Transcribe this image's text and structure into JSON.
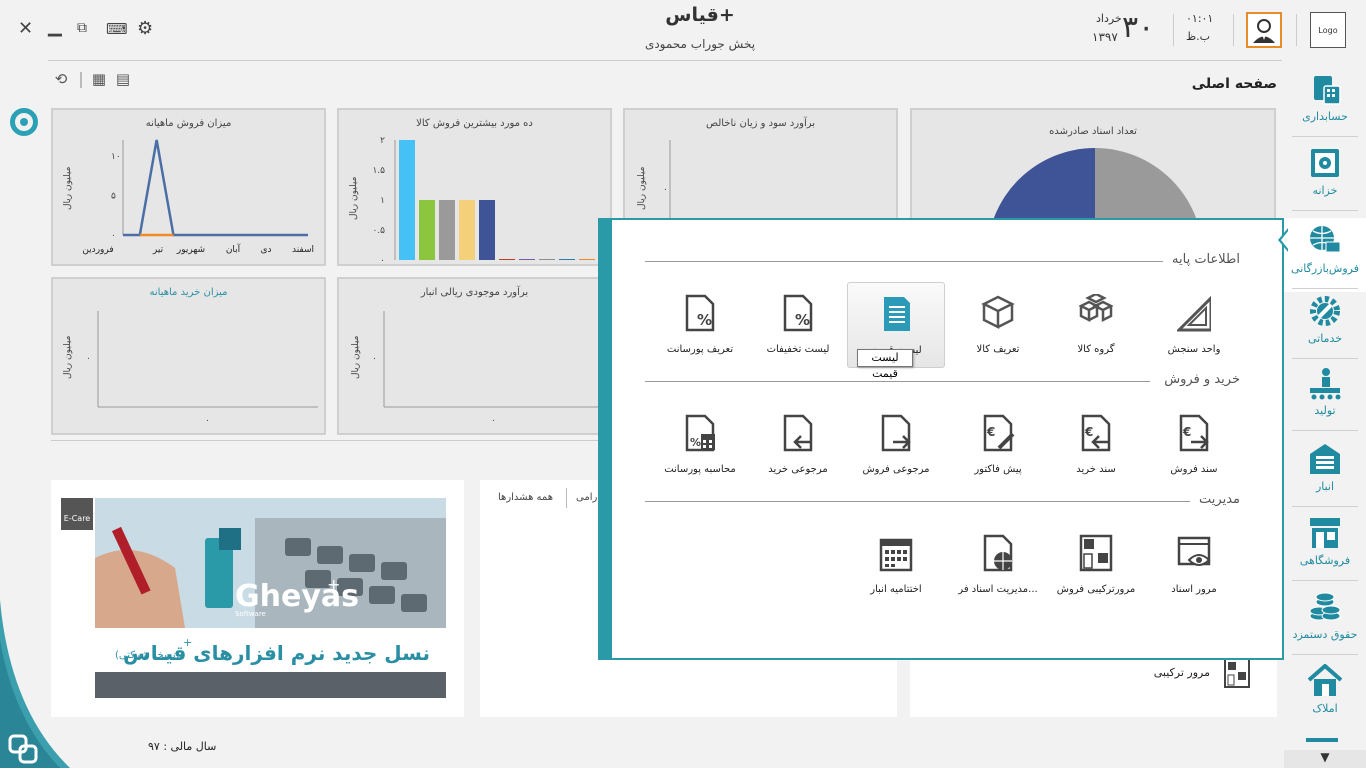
{
  "app": {
    "title": "قیاس+",
    "subtitle": "پخش جوراب محمودی",
    "logo_text": "Logo"
  },
  "header": {
    "day": "۳۰",
    "month": "خرداد",
    "year": "۱۳۹۷",
    "time": "۰۱:۰۱",
    "ampm": "ب.ظ",
    "page_title": "صفحه اصلی"
  },
  "window_controls": [
    "close-icon",
    "minimize-icon",
    "restore-icon",
    "keyboard-icon",
    "settings-icon"
  ],
  "toolbar_icons": [
    "refresh-icon",
    "grid-icon",
    "calendar-icon"
  ],
  "charts": [
    {
      "title": "میزان فروش ماهیانه",
      "ylabel": "میلیون ریال",
      "chart_data": {
        "type": "line",
        "categories": [
          "فروردین",
          "تیر",
          "شهریور",
          "آبان",
          "دی",
          "اسفند"
        ],
        "yticks": [
          "۰",
          "۵",
          "۱۰"
        ],
        "ylim": [
          0,
          12
        ],
        "series": [
          {
            "color": "#4a6fa5",
            "values": [
              0,
              0,
              12,
              0,
              0,
              0,
              0,
              0,
              0,
              0,
              0,
              0
            ]
          },
          {
            "color": "#f08a24",
            "values": [
              0,
              0,
              0,
              0,
              0,
              0,
              0,
              0,
              0,
              0,
              0,
              0
            ]
          }
        ]
      }
    },
    {
      "title": "ده مورد بیشترین فروش کالا",
      "ylabel": "میلیون ریال",
      "chart_data": {
        "type": "bar",
        "yticks": [
          "۰",
          "۰.۵",
          "۱",
          "۱.۵",
          "۲"
        ],
        "ylim": [
          0,
          2
        ],
        "values": [
          2,
          1,
          1,
          1,
          1,
          0,
          0,
          0,
          0,
          0
        ],
        "colors": [
          "#45c1f5",
          "#8cc63f",
          "#9a9a9a",
          "#f5d07a",
          "#3f5496",
          "#c23b22",
          "#7a5a9e",
          "#8e8e8e",
          "#2a7ab0",
          "#f08a24"
        ]
      }
    },
    {
      "title": "برآورد سود و زیان ناخالص",
      "ylabel": "میلیون ریال",
      "chart_data": {
        "type": "bar",
        "yticks": [
          "۰"
        ],
        "values": []
      }
    },
    {
      "title": "تعداد اسناد صادرشده",
      "chart_data": {
        "type": "pie",
        "values": [
          50,
          50
        ],
        "colors": [
          "#3f5496",
          "#9a9a9a"
        ]
      }
    },
    {
      "title": "میزان خرید ماهیانه",
      "ylabel": "میلیون ریال",
      "chart_data": {
        "type": "line",
        "yticks": [
          "۰"
        ],
        "xticks": [
          "۰"
        ],
        "values": []
      }
    },
    {
      "title": "برآورد موجودی ریالی انبار",
      "ylabel": "میلیون ریال",
      "chart_data": {
        "type": "bar",
        "yticks": [
          "۰"
        ],
        "xticks": [
          "۰"
        ],
        "values": []
      }
    }
  ],
  "messages": {
    "tab_all": "همه هشدارها",
    "tab_partial": "رامی"
  },
  "ad": {
    "brand": "Gheyas",
    "brand_sup": "+",
    "software": "Software",
    "tagline": "نسل جدید نرم افزارهای قیـاس",
    "tagline_sup": "+",
    "tagline_note": "(نسخه شرکتی)",
    "ecare": "E-Care"
  },
  "popup": {
    "sections": [
      {
        "title": "اطلاعات پایه",
        "items": [
          {
            "label": "واحد سنجش",
            "icon": "ruler-triangle-icon"
          },
          {
            "label": "گروه کالا",
            "icon": "boxes-icon"
          },
          {
            "label": "تعریف کالا",
            "icon": "box-icon"
          },
          {
            "label": "لیست قیمت",
            "icon": "document-list-icon"
          },
          {
            "label": "لیست تخفیفات",
            "icon": "percent-document-icon"
          },
          {
            "label": "تعریف پورسانت",
            "icon": "percent-document-icon"
          }
        ]
      },
      {
        "title": "خرید و فروش",
        "items": [
          {
            "label": "سند فروش",
            "icon": "euro-doc-out-icon"
          },
          {
            "label": "سند خرید",
            "icon": "euro-doc-in-icon"
          },
          {
            "label": "پیش فاکتور",
            "icon": "euro-doc-edit-icon"
          },
          {
            "label": "مرجوعی فروش",
            "icon": "doc-return-out-icon"
          },
          {
            "label": "مرجوعی خرید",
            "icon": "doc-return-in-icon"
          },
          {
            "label": "محاسبه پورسانت",
            "icon": "percent-calc-icon"
          }
        ]
      },
      {
        "title": "مدیریت",
        "items": [
          {
            "label": "مرور اسناد",
            "icon": "eye-window-icon"
          },
          {
            "label": "مرورترکیبی فروش",
            "icon": "combined-grid-icon"
          },
          {
            "label": "مدیریت اسناد فر...",
            "icon": "doc-globe-icon"
          },
          {
            "label": "اختتامیه انبار",
            "icon": "calendar-grid-icon"
          }
        ]
      }
    ],
    "tooltip": "لیست قیمت"
  },
  "sidebar": {
    "items": [
      {
        "label": "حسابداری",
        "icon": "accounting-icon"
      },
      {
        "label": "خزانه",
        "icon": "safe-icon"
      },
      {
        "label": "فروش‌بازرگانی",
        "icon": "globe-trade-icon"
      },
      {
        "label": "خدماتی",
        "icon": "gear-wrench-icon"
      },
      {
        "label": "تولید",
        "icon": "production-icon"
      },
      {
        "label": "انبار",
        "icon": "warehouse-icon"
      },
      {
        "label": "فروشگاهی",
        "icon": "store-icon"
      },
      {
        "label": "حقوق دستمزد",
        "icon": "coins-icon"
      },
      {
        "label": "املاک",
        "icon": "house-icon"
      }
    ],
    "scroll_down": "▼"
  },
  "footer": {
    "fiscal_year": "سال مالی : ۹۷",
    "mroor_label": "مرور ترکیبی"
  }
}
